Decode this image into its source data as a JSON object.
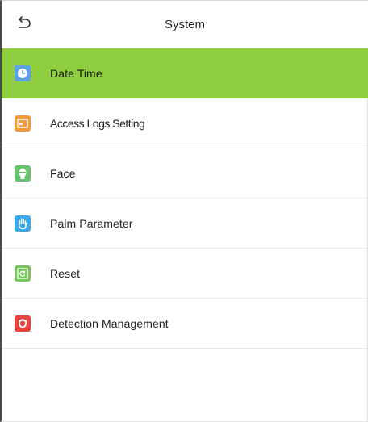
{
  "header": {
    "title": "System"
  },
  "menu": {
    "items": [
      {
        "label": "Date Time",
        "icon": "clock-icon",
        "color": "#5aa2e6",
        "selected": true
      },
      {
        "label": "Access Logs Setting",
        "icon": "access-logs-icon",
        "color": "#f39a3c"
      },
      {
        "label": "Face",
        "icon": "face-icon",
        "color": "#67c26b"
      },
      {
        "label": "Palm Parameter",
        "icon": "palm-icon",
        "color": "#3aa7e8"
      },
      {
        "label": "Reset",
        "icon": "reset-icon",
        "color": "#76c65a"
      },
      {
        "label": "Detection Management",
        "icon": "shield-icon",
        "color": "#e8423d"
      }
    ]
  },
  "colors": {
    "selected_background": "#8fce3e",
    "divider": "#e9e9e9"
  }
}
